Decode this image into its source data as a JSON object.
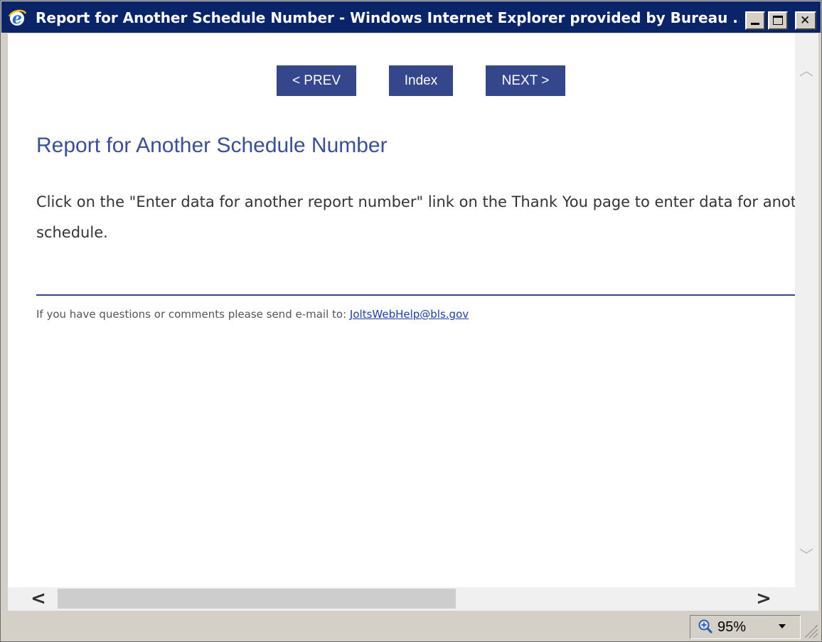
{
  "window": {
    "title": "Report for Another Schedule Number - Windows Internet Explorer provided by Bureau ...",
    "icon": "ie-icon",
    "controls": {
      "minimize": "minimize-button",
      "maximize": "maximize-button",
      "close": "✕"
    }
  },
  "nav": {
    "prev_label": "< PREV",
    "index_label": "Index",
    "next_label": "NEXT >",
    "button_color": "#34468c"
  },
  "page": {
    "title": "Report for Another Schedule Number",
    "body": "Click on the \"Enter data for another report number\" link on the Thank You page to enter data for another schedule.",
    "footer_text": "If you have questions or comments please send e-mail to: ",
    "footer_link": "JoltsWebHelp@bls.gov",
    "title_color": "#3a4f9a"
  },
  "scrollbars": {
    "up": "︿",
    "down": "﹀",
    "left": "<",
    "right": ">"
  },
  "status": {
    "zoom_level": "95%",
    "zoom_icon": "zoom-icon"
  }
}
